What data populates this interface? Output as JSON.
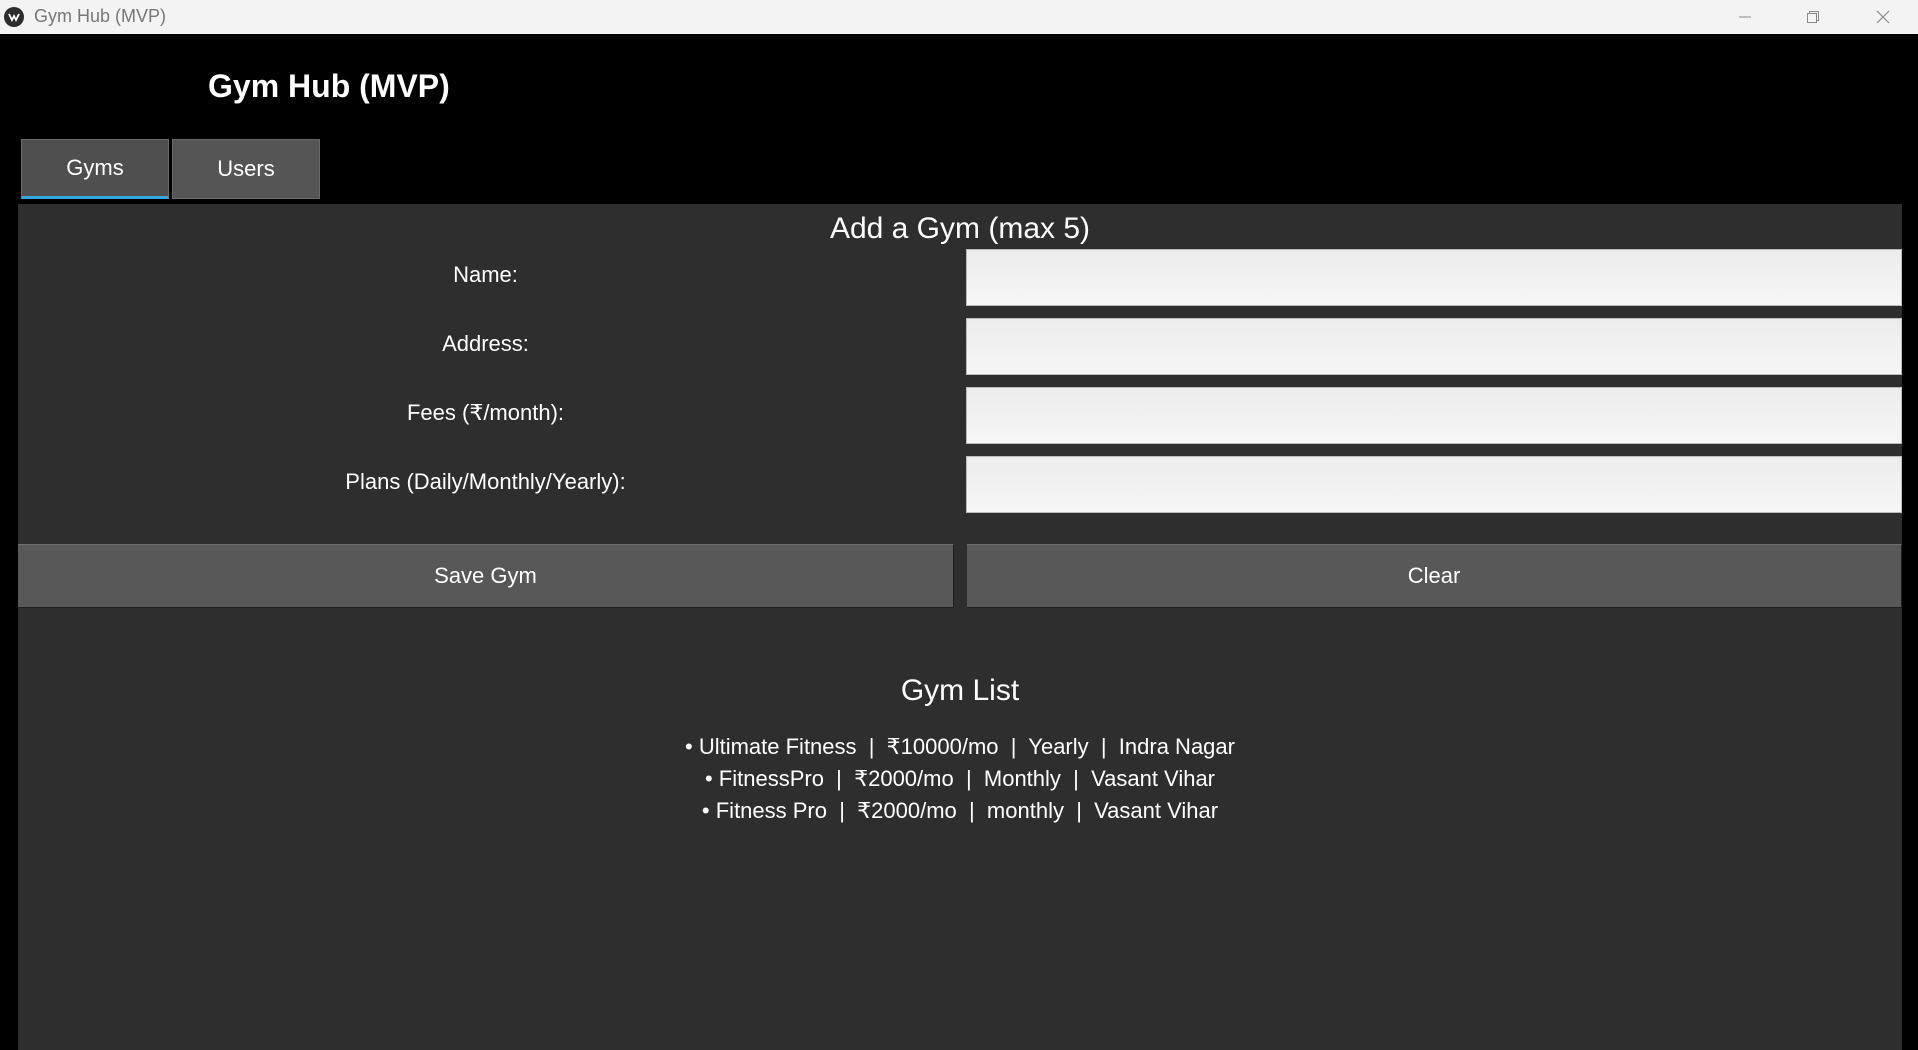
{
  "window": {
    "title": "Gym Hub (MVP)",
    "minimize_icon": "minimize-icon",
    "restore_icon": "restore-icon",
    "close_icon": "close-icon"
  },
  "app": {
    "title": "Gym Hub (MVP)"
  },
  "tabs": [
    {
      "label": "Gyms",
      "active": true
    },
    {
      "label": "Users",
      "active": false
    }
  ],
  "form": {
    "heading": "Add a Gym (max 5)",
    "fields": [
      {
        "label": "Name:",
        "value": "",
        "placeholder": ""
      },
      {
        "label": "Address:",
        "value": "",
        "placeholder": ""
      },
      {
        "label": "Fees (₹/month):",
        "value": "",
        "placeholder": ""
      },
      {
        "label": "Plans (Daily/Monthly/Yearly):",
        "value": "",
        "placeholder": ""
      }
    ],
    "save_label": "Save Gym",
    "clear_label": "Clear"
  },
  "gym_list": {
    "heading": "Gym List",
    "items": [
      "• Ultimate Fitness  |  ₹10000/mo  |  Yearly  |  Indra Nagar",
      "• FitnessPro  |  ₹2000/mo  |  Monthly  |  Vasant Vihar",
      "• Fitness Pro  |  ₹2000/mo  |  monthly  |  Vasant Vihar"
    ]
  },
  "colors": {
    "tab_accent": "#35a7e0",
    "panel_bg": "#2e2e2e",
    "button_bg": "#585858"
  }
}
